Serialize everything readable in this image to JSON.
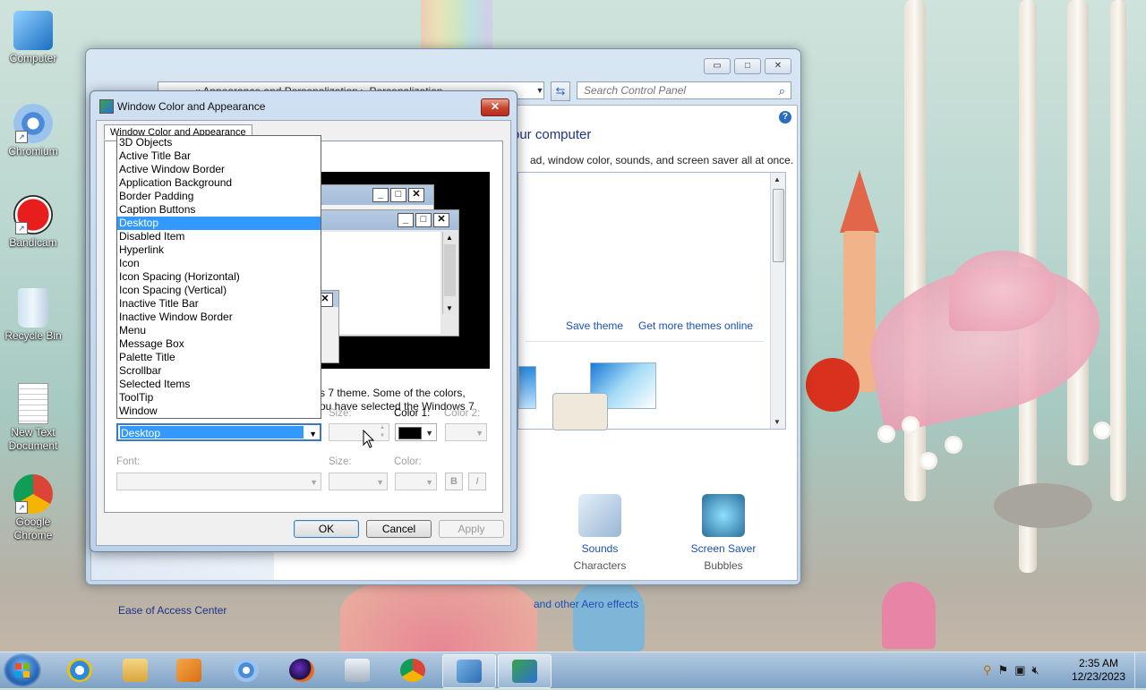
{
  "desktop": {
    "icons": [
      {
        "label": "Computer"
      },
      {
        "label": "Chromium"
      },
      {
        "label": "Bandicam"
      },
      {
        "label": "Recycle Bin"
      },
      {
        "label": "New Text Document"
      },
      {
        "label": "Google Chrome"
      }
    ]
  },
  "control_panel": {
    "breadcrumb": "«  Appearance and Personalization  ▸  Personalization",
    "search_placeholder": "Search Control Panel",
    "heading": "our computer",
    "subtitle": "ad, window color, sounds, and screen saver all at once.",
    "save_theme": "Save theme",
    "get_more_themes": "Get more themes online",
    "sounds_label": "Sounds",
    "sounds_sub": "Characters",
    "screensaver_label": "Screen Saver",
    "screensaver_sub": "Bubbles",
    "left_link": "Ease of Access Center",
    "aero_link": "and other Aero effects"
  },
  "dialog": {
    "title": "Window Color and Appearance",
    "close": "✕",
    "tab": "Window Color and Appearance",
    "description_line1": "s 7 theme.  Some of the colors,",
    "description_line2": "ou have selected the Windows 7",
    "item_selected": "Desktop",
    "size_label": "Size:",
    "color1_label": "Color 1:",
    "color2_label": "Color 2:",
    "font_label": "Font:",
    "font_size_label": "Size:",
    "font_color_label": "Color:",
    "bold": "B",
    "italic": "I",
    "ok": "OK",
    "cancel": "Cancel",
    "apply": "Apply",
    "color1_value": "#000000"
  },
  "item_list": [
    "3D Objects",
    "Active Title Bar",
    "Active Window Border",
    "Application Background",
    "Border Padding",
    "Caption Buttons",
    "Desktop",
    "Disabled Item",
    "Hyperlink",
    "Icon",
    "Icon Spacing (Horizontal)",
    "Icon Spacing (Vertical)",
    "Inactive Title Bar",
    "Inactive Window Border",
    "Menu",
    "Message Box",
    "Palette Title",
    "Scrollbar",
    "Selected Items",
    "ToolTip",
    "Window"
  ],
  "selected_index": 6,
  "taskbar": {
    "time": "2:35 AM",
    "date": "12/23/2023"
  }
}
